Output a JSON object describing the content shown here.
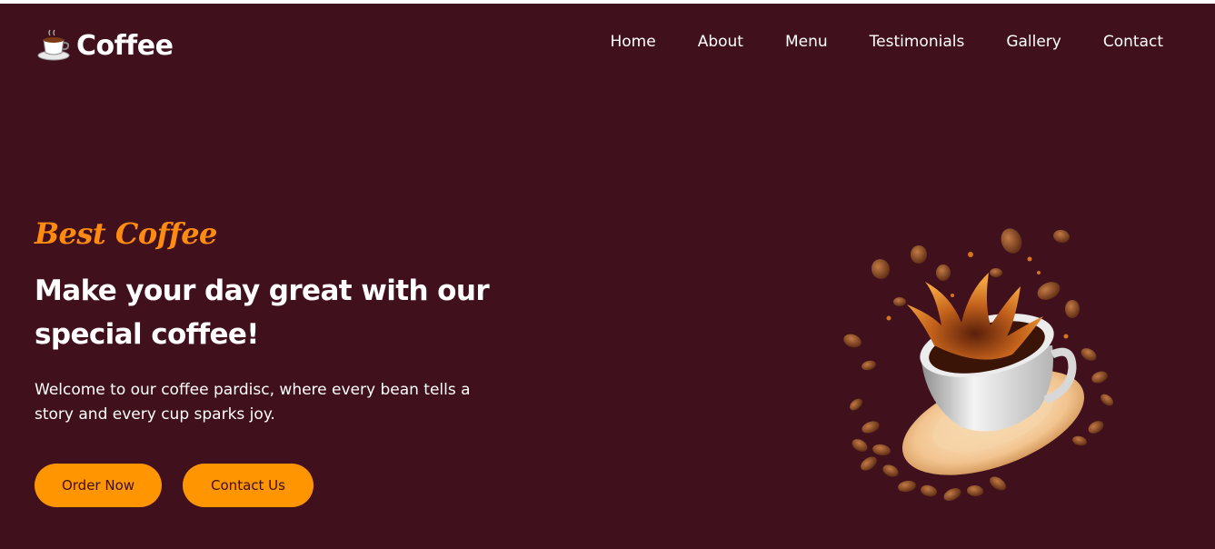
{
  "header": {
    "logo_text": "Coffee",
    "logo_icon": "coffee-cup-icon",
    "nav": [
      {
        "label": "Home"
      },
      {
        "label": "About"
      },
      {
        "label": "Menu"
      },
      {
        "label": "Testimonials"
      },
      {
        "label": "Gallery"
      },
      {
        "label": "Contact"
      }
    ]
  },
  "hero": {
    "tagline": "Best Coffee",
    "headline": "Make your day great with our special coffee!",
    "description": "Welcome to our coffee pardisc, where every bean tells a story and every cup sparks joy.",
    "buttons": {
      "order": "Order Now",
      "contact": "Contact Us"
    },
    "image": "coffee-splash-cup-image"
  },
  "colors": {
    "background": "#40111c",
    "accent": "#ff9500",
    "tagline": "#ff8c10",
    "text": "#ffffff",
    "button_text": "#3b0f16"
  }
}
